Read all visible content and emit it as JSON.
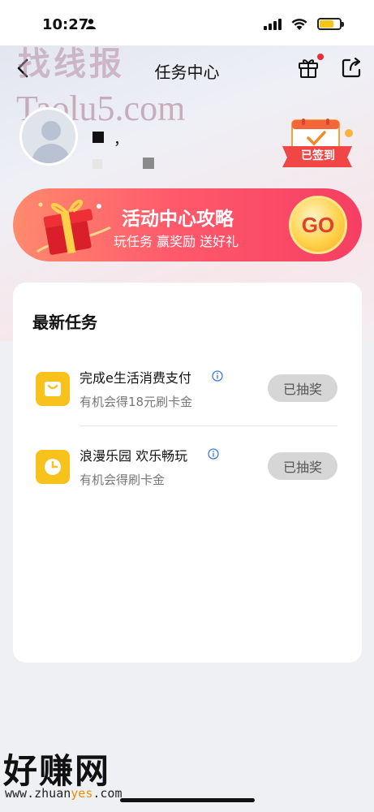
{
  "status_bar": {
    "time": "10:27"
  },
  "nav": {
    "title": "任务中心"
  },
  "watermarks": {
    "top_cn": "找线报",
    "top_url": "Taolu5.com",
    "bottom_cn": "好赚网",
    "bottom_url_prefix": "www.zhuan",
    "bottom_url_highlight": "yes",
    "bottom_url_suffix": ".com"
  },
  "user": {
    "name_fragment": "，"
  },
  "sign_badge": {
    "label": "已签到"
  },
  "banner": {
    "title": "活动中心攻略",
    "subtitle": "玩任务 赢奖励 送好礼",
    "go_label": "GO"
  },
  "tasks_card": {
    "title": "最新任务",
    "tasks": [
      {
        "name": "完成e生活消费支付",
        "description": "有机会得18元刷卡金",
        "button": "已抽奖",
        "icon": "shopping-bag-icon"
      },
      {
        "name": "浪漫乐园 欢乐畅玩",
        "description": "有机会得刷卡金",
        "button": "已抽奖",
        "icon": "clock-icon"
      }
    ]
  },
  "colors": {
    "banner_start": "#ff8a6d",
    "banner_end": "#f53e63",
    "task_icon_bg": "#f7c21c",
    "done_button_bg": "#d6d6d6",
    "notify_dot": "#e92d36"
  }
}
